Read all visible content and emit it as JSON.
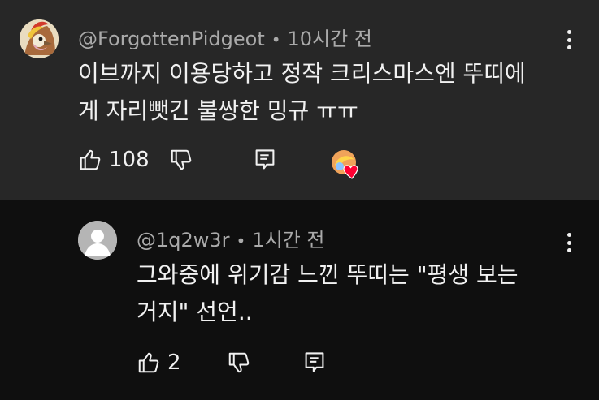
{
  "comment": {
    "author": "@ForgottenPidgeot",
    "separator": "•",
    "time": "10시간 전",
    "text": "이브까지 이용당하고 정작 크리스마스엔 뚜띠에\n게 자리뺏긴 불쌍한 밍규 ㅠㅠ",
    "likes": "108",
    "avatar_icon": "pidgeot-avatar-icon",
    "heart_badge": "creator-heart-icon",
    "colors": {
      "background": "#272727",
      "heart": "#ff0033"
    }
  },
  "reply": {
    "author": "@1q2w3r",
    "separator": "•",
    "time": "1시간 전",
    "text": "그와중에 위기감 느낀 뚜띠는 \"평생 보는\n거지\" 선언..",
    "likes": "2",
    "avatar_icon": "default-user-avatar-icon",
    "colors": {
      "background": "#0f0f0f"
    }
  },
  "icons": {
    "like": "thumbs-up-icon",
    "dislike": "thumbs-down-icon",
    "reply": "reply-comment-icon",
    "menu": "more-vertical-icon"
  }
}
